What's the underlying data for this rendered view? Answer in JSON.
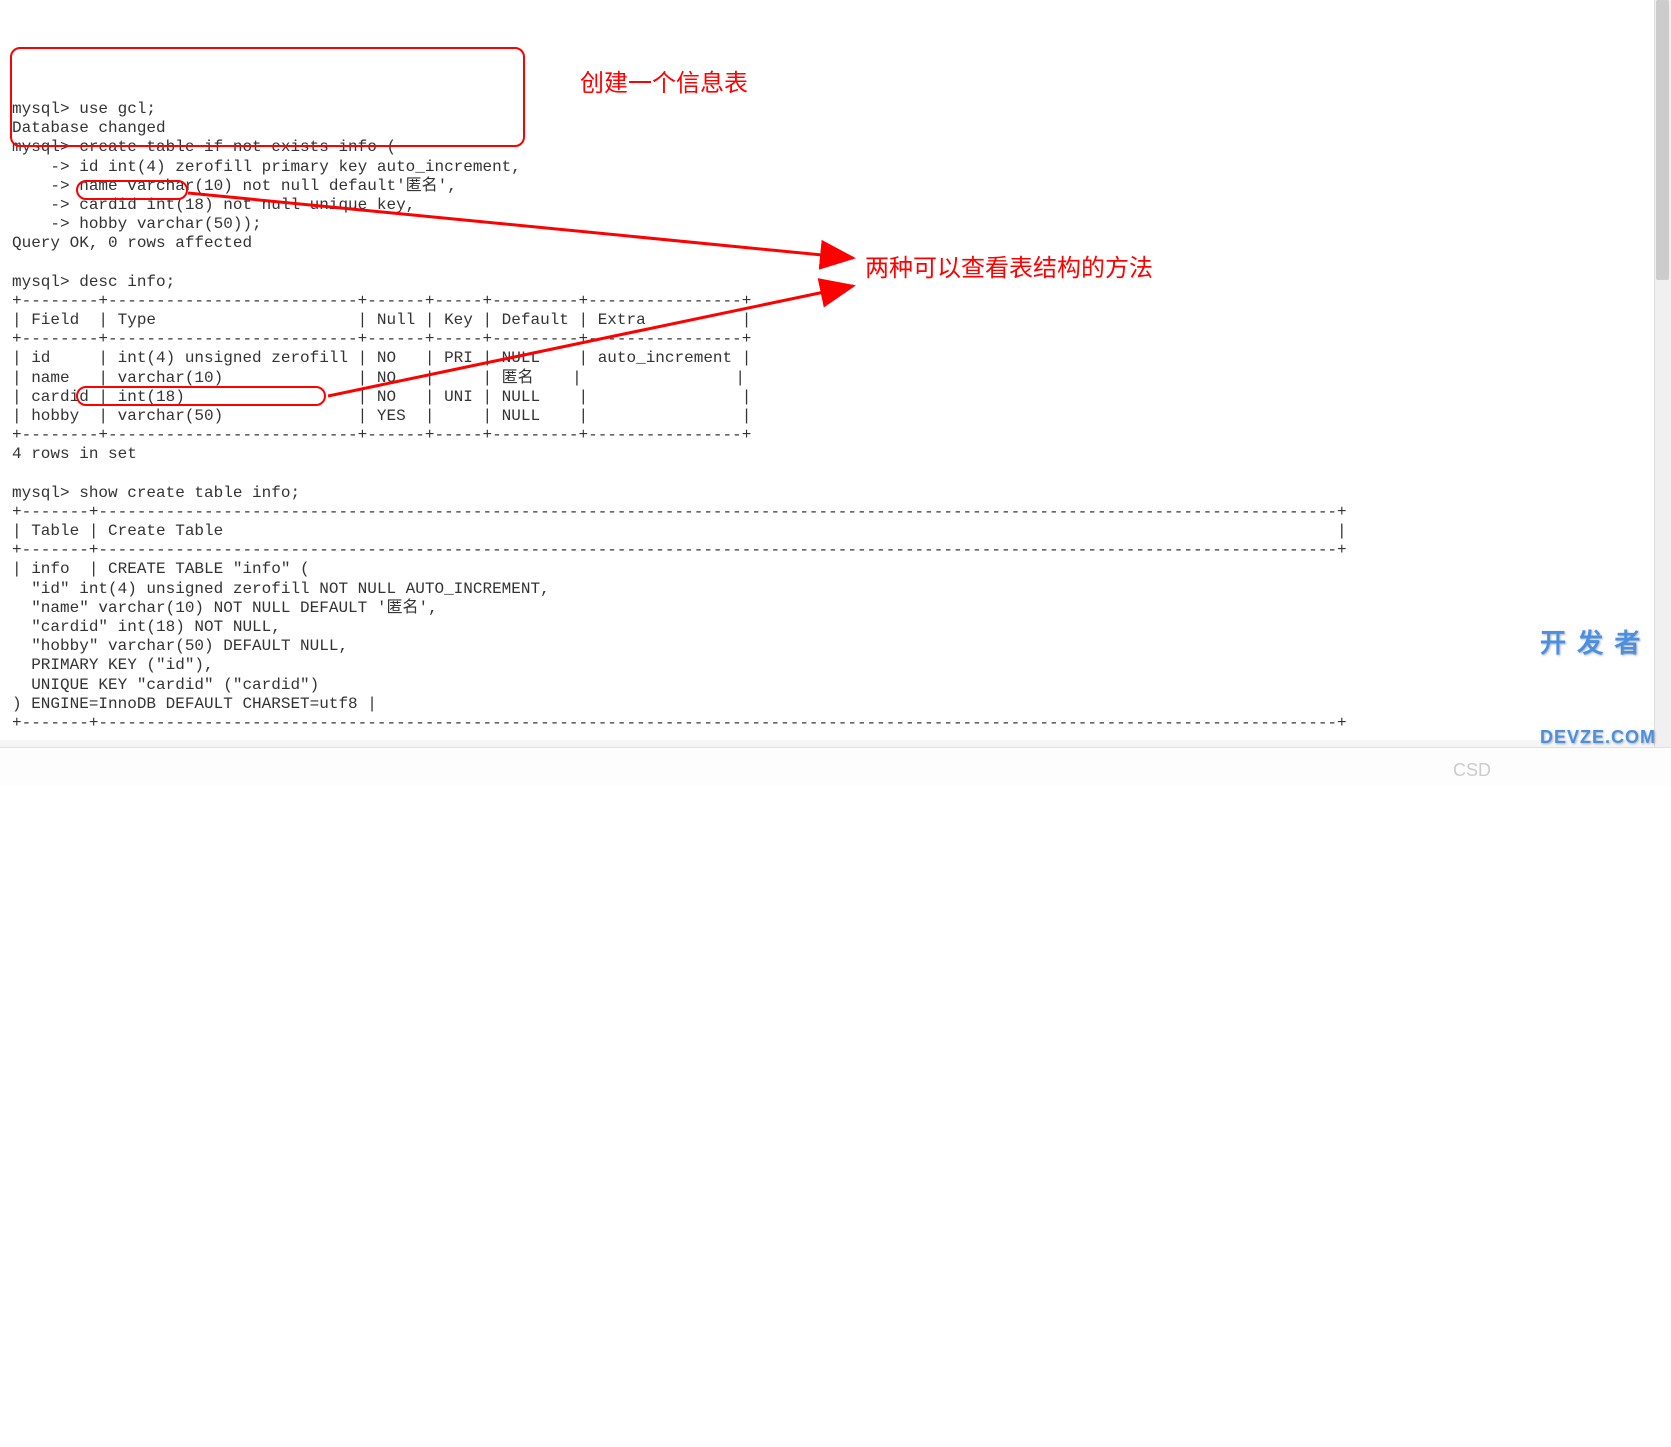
{
  "terminal": {
    "prompt": "mysql>",
    "cont_prompt": "    ->",
    "lines": {
      "use_db": " use gcl;",
      "db_changed": "Database changed",
      "create1": " create table if not exists info (",
      "create2": " id int(4) zerofill primary key auto_increment,",
      "create3": " name varchar(10) not null default'匿名',",
      "create4": " cardid int(18) not null unique key,",
      "create5": " hobby varchar(50));",
      "query_ok": "Query OK, 0 rows affected",
      "blank": "",
      "desc_cmd": " desc info;",
      "sep1": "+--------+--------------------------+------+-----+---------+----------------+",
      "hdr": "| Field  | Type                     | Null | Key | Default | Extra          |",
      "row1": "| id     | int(4) unsigned zerofill | NO   | PRI | NULL    | auto_increment |",
      "row2": "| name   | varchar(10)              | NO   |     | 匿名    |                |",
      "row3": "| cardid | int(18)                  | NO   | UNI | NULL    |                |",
      "row4": "| hobby  | varchar(50)              | YES  |     | NULL    |                |",
      "rows_in_set": "4 rows in set",
      "show_cmd": " show create table info;",
      "sep2": "+-------+---------------------------------------------------------------------------------------------------------------------------------+",
      "hdr2": "| Table | Create Table                                                                                                                    |",
      "ct1": "| info  | CREATE TABLE \"info\" (",
      "ct2": "  \"id\" int(4) unsigned zerofill NOT NULL AUTO_INCREMENT,",
      "ct3": "  \"name\" varchar(10) NOT NULL DEFAULT '匿名',",
      "ct4": "  \"cardid\" int(18) NOT NULL,",
      "ct5": "  \"hobby\" varchar(50) DEFAULT NULL,",
      "ct6": "  PRIMARY KEY (\"id\"),",
      "ct7": "  UNIQUE KEY \"cardid\" (\"cardid\")",
      "ct8": ") ENGINE=InnoDB DEFAULT CHARSET=utf8 |"
    }
  },
  "annotations": {
    "create_label": "创建一个信息表",
    "methods_label": "两种可以查看表结构的方法"
  },
  "watermark": {
    "dev": "开 发 者",
    "dev2": "DEVZE.COM",
    "csd": "CSD"
  }
}
